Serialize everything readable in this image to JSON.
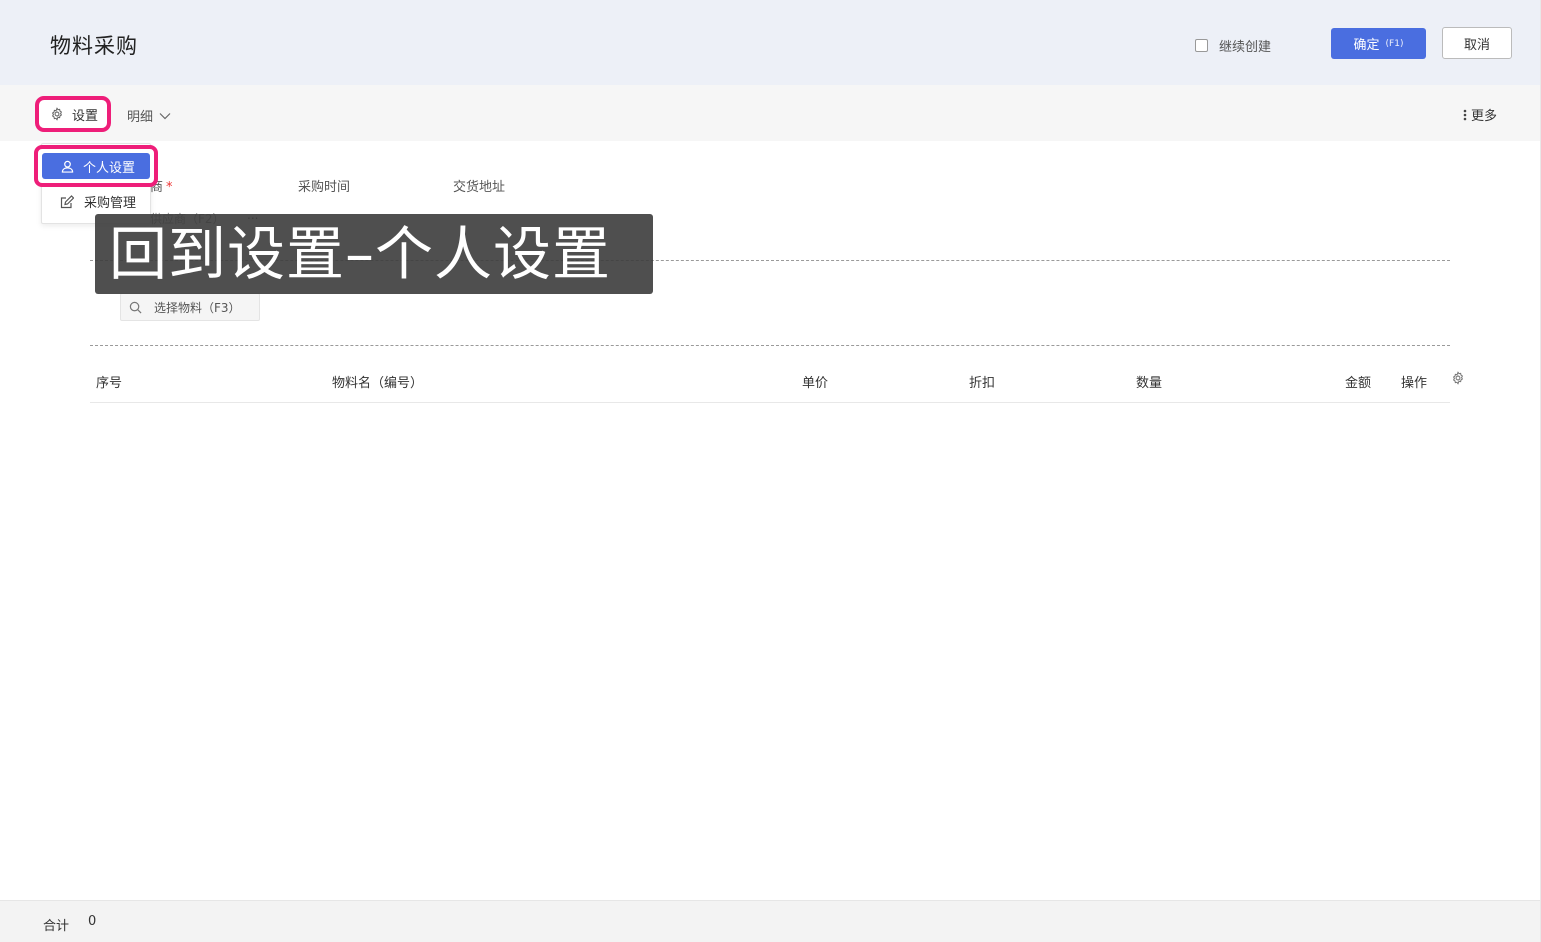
{
  "header": {
    "title": "物料采购",
    "continue_create_label": "继续创建",
    "confirm_label": "确定",
    "confirm_key": "(F1)",
    "cancel_label": "取消"
  },
  "toolbar": {
    "settings_label": "设置",
    "detail_label": "明细",
    "more_label": "更多"
  },
  "settings_menu": {
    "items": [
      {
        "label": "个人设置",
        "icon": "user-icon",
        "active": true
      },
      {
        "label": "采购管理",
        "icon": "edit-icon",
        "active": false
      }
    ]
  },
  "form": {
    "supplier_label_visible": "商",
    "purchase_time_label": "采购时间",
    "delivery_address_label": "交货地址",
    "supplier_placeholder": "供应商（F2）",
    "supplier_more": "..."
  },
  "material_search": {
    "placeholder": "选择物料（F3）"
  },
  "table": {
    "columns": [
      "序号",
      "物料名（编号）",
      "单价",
      "折扣",
      "数量",
      "金额",
      "操作"
    ],
    "rows": []
  },
  "caption": "回到设置–个人设置",
  "footer": {
    "total_label": "合计",
    "total_value": "0"
  },
  "colors": {
    "accent": "#4a6ee0",
    "highlight": "#ee1e79",
    "header_bg": "#edf0f7"
  }
}
